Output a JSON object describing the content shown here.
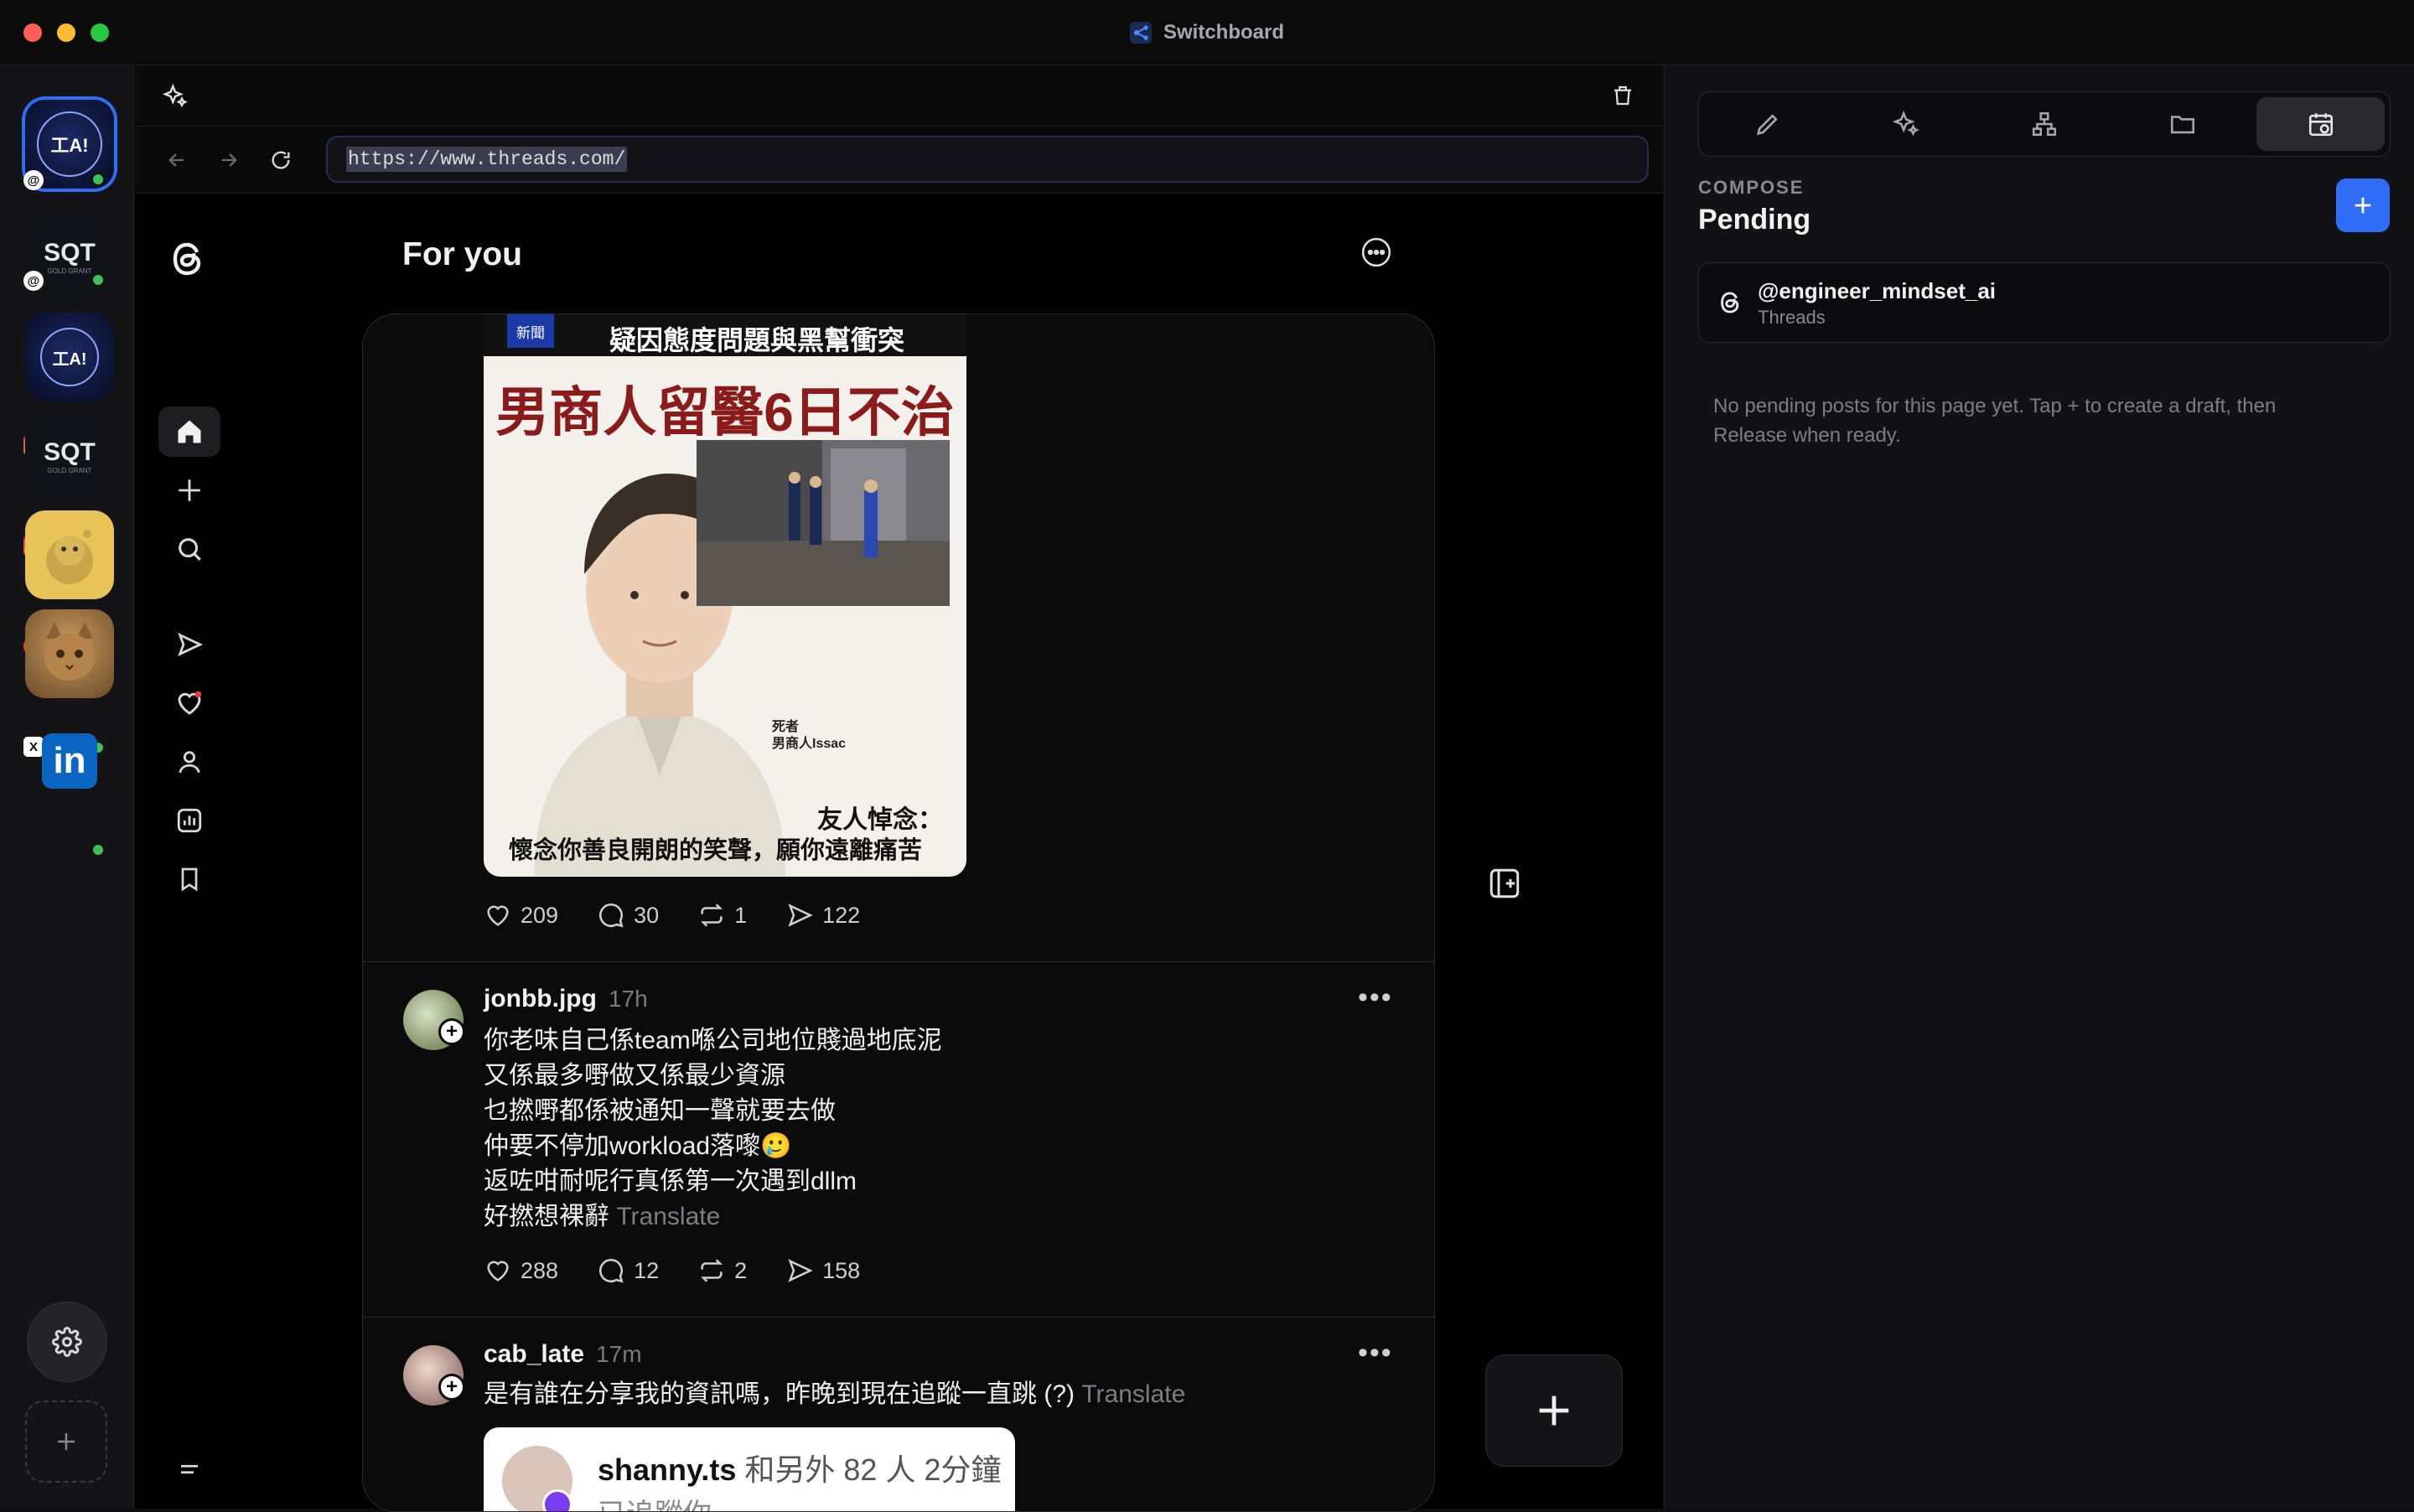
{
  "app": {
    "title": "Switchboard"
  },
  "rail": {
    "accounts": [
      {
        "label": "Threads account AI logo",
        "platform": "threads"
      },
      {
        "label": "SQT Threads",
        "platform": "threads"
      },
      {
        "label": "AI Instagram",
        "platform": "instagram"
      },
      {
        "label": "SQT Instagram",
        "platform": "instagram"
      },
      {
        "label": "Reddit account",
        "platform": "reddit"
      },
      {
        "label": "X cat account",
        "platform": "x"
      },
      {
        "label": "LinkedIn",
        "platform": "linkedin"
      }
    ],
    "logo_ai": "工A!",
    "logo_sqt": "SQT",
    "logo_linkedin": "in",
    "online_color": "#3fbf5a"
  },
  "browser": {
    "url": "https://www.threads.com/"
  },
  "threads": {
    "feed_title": "For you",
    "posts": [
      {
        "image": {
          "tag": "新聞",
          "subtitle": "疑因態度問題與黑幫衝突",
          "headline": "男商人留醫6日不治",
          "caption_small_1": "死者",
          "caption_small_2": "男商人Issac",
          "quote_title": "友人悼念：",
          "quote_body": "懷念你善良開朗的笑聲，願你遠離痛苦"
        },
        "likes": "209",
        "comments": "30",
        "reposts": "1",
        "shares": "122"
      },
      {
        "user": "jonbb.jpg",
        "time": "17h",
        "lines": [
          "你老味自己係team喺公司地位賤過地底泥",
          "又係最多嘢做又係最少資源",
          "乜撚嘢都係被通知一聲就要去做",
          "仲要不停加workload落嚟🥲",
          "返咗咁耐呢行真係第一次遇到dllm",
          "好撚想裸辭"
        ],
        "translate": "Translate",
        "likes": "288",
        "comments": "12",
        "reposts": "2",
        "shares": "158"
      },
      {
        "user": "cab_late",
        "time": "17m",
        "text": "是有誰在分享我的資訊嗎，昨晚到現在追蹤一直跳 (?)",
        "translate": "Translate",
        "embed": {
          "name": "shanny.ts",
          "meta": "和另外 82 人 2分鐘",
          "sub": "已追蹤你"
        }
      }
    ]
  },
  "panel": {
    "section_label": "COMPOSE",
    "title": "Pending",
    "account": {
      "handle": "@engineer_mindset_ai",
      "platform": "Threads"
    },
    "empty_message_line1": "No pending posts for this page yet. Tap + to create a draft, then",
    "empty_message_line2": "Release when ready.",
    "accent": "#2f6df6"
  }
}
